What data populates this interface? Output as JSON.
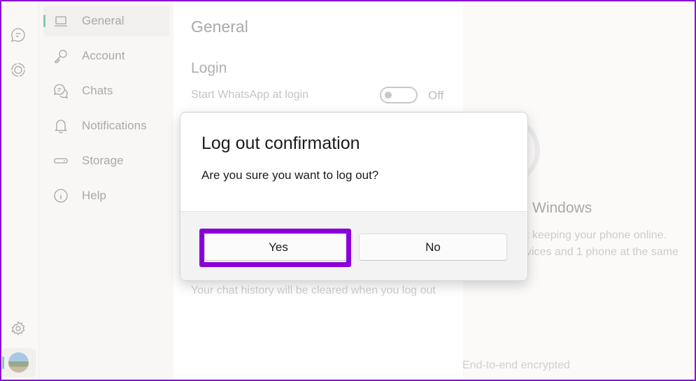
{
  "rail": {
    "icons": [
      "chats-icon",
      "status-icon",
      "settings-icon"
    ]
  },
  "nav": {
    "items": [
      {
        "label": "General",
        "icon": "laptop-icon",
        "active": true
      },
      {
        "label": "Account",
        "icon": "key-icon"
      },
      {
        "label": "Chats",
        "icon": "chats-icon"
      },
      {
        "label": "Notifications",
        "icon": "bell-icon"
      },
      {
        "label": "Storage",
        "icon": "storage-icon"
      },
      {
        "label": "Help",
        "icon": "info-icon"
      }
    ]
  },
  "content": {
    "title": "General",
    "section": "Login",
    "start_login_label": "Start WhatsApp at login",
    "toggle_state": "Off",
    "history_note": "Your chat history will be cleared when you log out"
  },
  "right": {
    "heading_fragment": "Windows",
    "line1": "t keeping your phone online.",
    "line2": "vices and 1 phone at the same",
    "encrypted": "End-to-end encrypted"
  },
  "dialog": {
    "title": "Log out confirmation",
    "message": "Are you sure you want to log out?",
    "yes": "Yes",
    "no": "No"
  },
  "colors": {
    "accent": "#86c9ad",
    "highlight": "#8a00d8"
  }
}
